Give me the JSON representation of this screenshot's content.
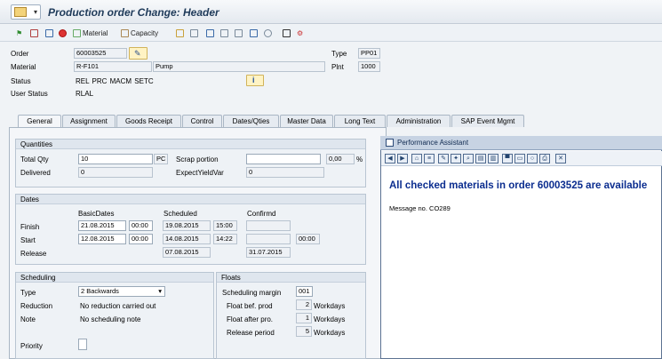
{
  "window": {
    "title": "Production order Change: Header"
  },
  "toolbar": {
    "material_label": "Material",
    "capacity_label": "Capacity"
  },
  "header": {
    "order_label": "Order",
    "order_value": "60003525",
    "type_label": "Type",
    "type_value": "PP01",
    "material_label": "Material",
    "material_value": "R-F101",
    "material_desc": "Pump",
    "plnt_label": "Plnt",
    "plnt_value": "1000",
    "status_label": "Status",
    "status_value": "REL  PRC  MACM SETC",
    "user_status_label": "User Status",
    "user_status_value": "RLAL"
  },
  "tabs": [
    "General",
    "Assignment",
    "Goods Receipt",
    "Control",
    "Dates/Qties",
    "Master Data",
    "Long Text",
    "Administration",
    "SAP Event Mgmt"
  ],
  "quantities": {
    "title": "Quantities",
    "total_qty_label": "Total Qty",
    "total_qty_value": "10",
    "unit": "PC",
    "scrap_label": "Scrap portion",
    "scrap_value": "",
    "scrap_pct": "0,00",
    "pct_sign": "%",
    "delivered_label": "Delivered",
    "delivered_value": "0",
    "expect_label": "ExpectYieldVar",
    "expect_value": "0"
  },
  "dates": {
    "title": "Dates",
    "col_basic": "BasicDates",
    "col_scheduled": "Scheduled",
    "col_confirmd": "Confirmd",
    "finish_label": "Finish",
    "finish_basic": "21.08.2015",
    "finish_basic_time": "00:00",
    "finish_sched": "19.08.2015",
    "finish_sched_time": "15:00",
    "start_label": "Start",
    "start_basic": "12.08.2015",
    "start_basic_time": "00:00",
    "start_sched": "14.08.2015",
    "start_sched_time": "14:22",
    "start_conf_time": "00:00",
    "release_label": "Release",
    "release_sched": "07.08.2015",
    "release_conf": "31.07.2015"
  },
  "scheduling": {
    "title": "Scheduling",
    "type_label": "Type",
    "type_value": "2 Backwards",
    "reduction_label": "Reduction",
    "reduction_value": "No reduction carried out",
    "note_label": "Note",
    "note_value": "No scheduling note",
    "priority_label": "Priority"
  },
  "floats": {
    "title": "Floats",
    "margin_label": "Scheduling margin",
    "margin_value": "001",
    "bef_label": "Float bef. prod",
    "bef_value": "2",
    "bef_unit": "Workdays",
    "after_label": "Float after pro.",
    "after_value": "1",
    "after_unit": "Workdays",
    "release_label": "Release period",
    "release_value": "5",
    "release_unit": "Workdays"
  },
  "assistant": {
    "title": "Performance Assistant",
    "message": "All checked materials in order 60003525 are available",
    "message_no": "Message no. CO289"
  }
}
